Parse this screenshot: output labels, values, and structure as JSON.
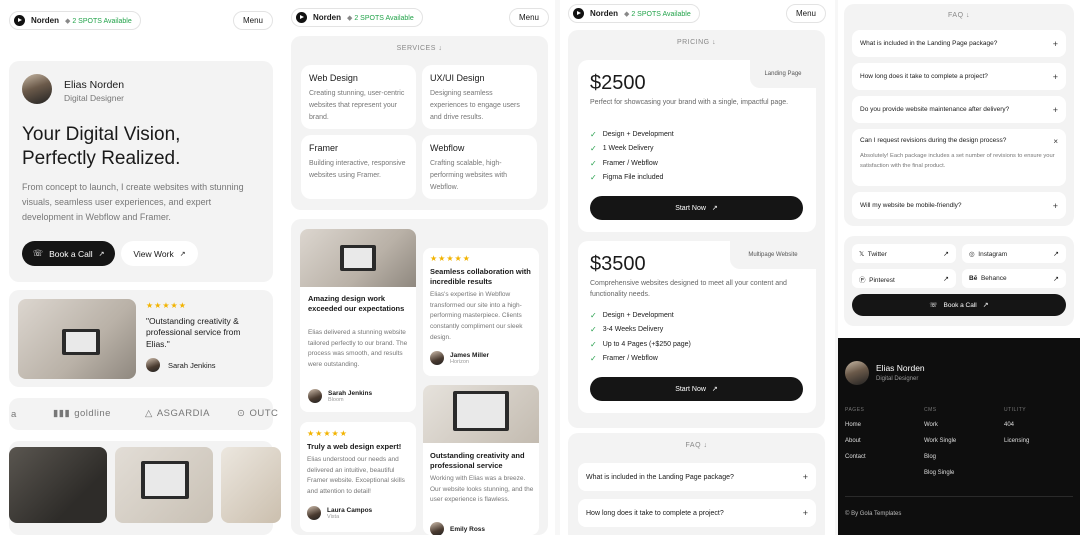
{
  "nav": {
    "brand": "Norden",
    "spots": "2 SPOTS",
    "available": "Available",
    "menu": "Menu"
  },
  "hero": {
    "name": "Elias Norden",
    "role": "Digital Designer",
    "headline_1": "Your Digital Vision,",
    "headline_2": "Perfectly Realized.",
    "description": "From concept to launch, I create websites with stunning visuals, seamless user experiences, and expert development in Webflow and Framer.",
    "cta_primary": "Book a Call",
    "cta_secondary": "View Work"
  },
  "hero_testimonial": {
    "stars": "★★★★★",
    "quote": "\"Outstanding creativity & professional service from Elias.\"",
    "author": "Sarah Jenkins"
  },
  "logos": [
    "a",
    "goldline",
    "ASGARDIA",
    "OUTC"
  ],
  "services": {
    "label": "SERVICES",
    "items": [
      {
        "title": "Web Design",
        "desc": "Creating stunning, user-centric websites that represent your brand."
      },
      {
        "title": "UX/UI Design",
        "desc": "Designing seamless experiences to engage users and drive results."
      },
      {
        "title": "Framer",
        "desc": "Building interactive, responsive websites using Framer."
      },
      {
        "title": "Webflow",
        "desc": "Crafting scalable, high-performing websites with Webflow."
      }
    ]
  },
  "testimonials": [
    {
      "stars": "★★★★★",
      "title": "Amazing design work exceeded our expectations",
      "body": "Elias delivered a stunning website tailored perfectly to our brand. The process was smooth, and results were outstanding.",
      "name": "Sarah Jenkins",
      "company": "Bloom"
    },
    {
      "stars": "★★★★★",
      "title": "Seamless collaboration with incredible results",
      "body": "Elias's expertise in Webflow transformed our site into a high-performing masterpiece. Clients constantly compliment our sleek design.",
      "name": "James Miller",
      "company": "Horizon"
    },
    {
      "stars": "★★★★★",
      "title": "Truly a web design expert!",
      "body": "Elias understood our needs and delivered an intuitive, beautiful Framer website. Exceptional skills and attention to detail!",
      "name": "Laura Campos",
      "company": "Vista"
    },
    {
      "stars": "",
      "title": "Outstanding creativity and professional service",
      "body": "Working with Elias was a breeze. Our website looks stunning, and the user experience is flawless.",
      "name": "Emily Ross",
      "company": ""
    }
  ],
  "pricing": {
    "label": "PRICING",
    "plans": [
      {
        "tag": "Landing Page",
        "price": "$2500",
        "desc": "Perfect for showcasing your brand with a single, impactful page.",
        "features": [
          "Design + Development",
          "1 Week Delivery",
          "Framer / Webflow",
          "Figma File included"
        ],
        "cta": "Start Now"
      },
      {
        "tag": "Multipage Website",
        "price": "$3500",
        "desc": "Comprehensive websites designed to meet all your content and functionality needs.",
        "features": [
          "Design + Development",
          "3-4 Weeks Delivery",
          "Up to 4 Pages (+$250 page)",
          "Framer / Webflow"
        ],
        "cta": "Start Now"
      }
    ]
  },
  "faq_bottom": {
    "label": "FAQ",
    "items": [
      "What is included in the Landing Page package?",
      "How long does it take to complete a project?"
    ]
  },
  "faq": {
    "label": "FAQ",
    "items": [
      "What is included in the Landing Page package?",
      "How long does it take to complete a project?",
      "Do you provide website maintenance after delivery?",
      "Can I request revisions during the design process?",
      "Will my website be mobile-friendly?"
    ],
    "open_answer": "Absolutely! Each package includes a set number of revisions to ensure your satisfaction with the final product."
  },
  "socials": [
    "Twitter",
    "Instagram",
    "Pinterest",
    "Behance"
  ],
  "book_call": "Book a Call",
  "footer": {
    "name": "Elias Norden",
    "role": "Digital Designer",
    "pages_h": "PAGES",
    "pages": [
      "Home",
      "About",
      "Contact"
    ],
    "cms_h": "CMS",
    "cms": [
      "Work",
      "Work Single",
      "Blog",
      "Blog Single"
    ],
    "utility_h": "UTILITY",
    "utility": [
      "404",
      "Licensing"
    ],
    "copyright": "© By Gola Templates"
  }
}
